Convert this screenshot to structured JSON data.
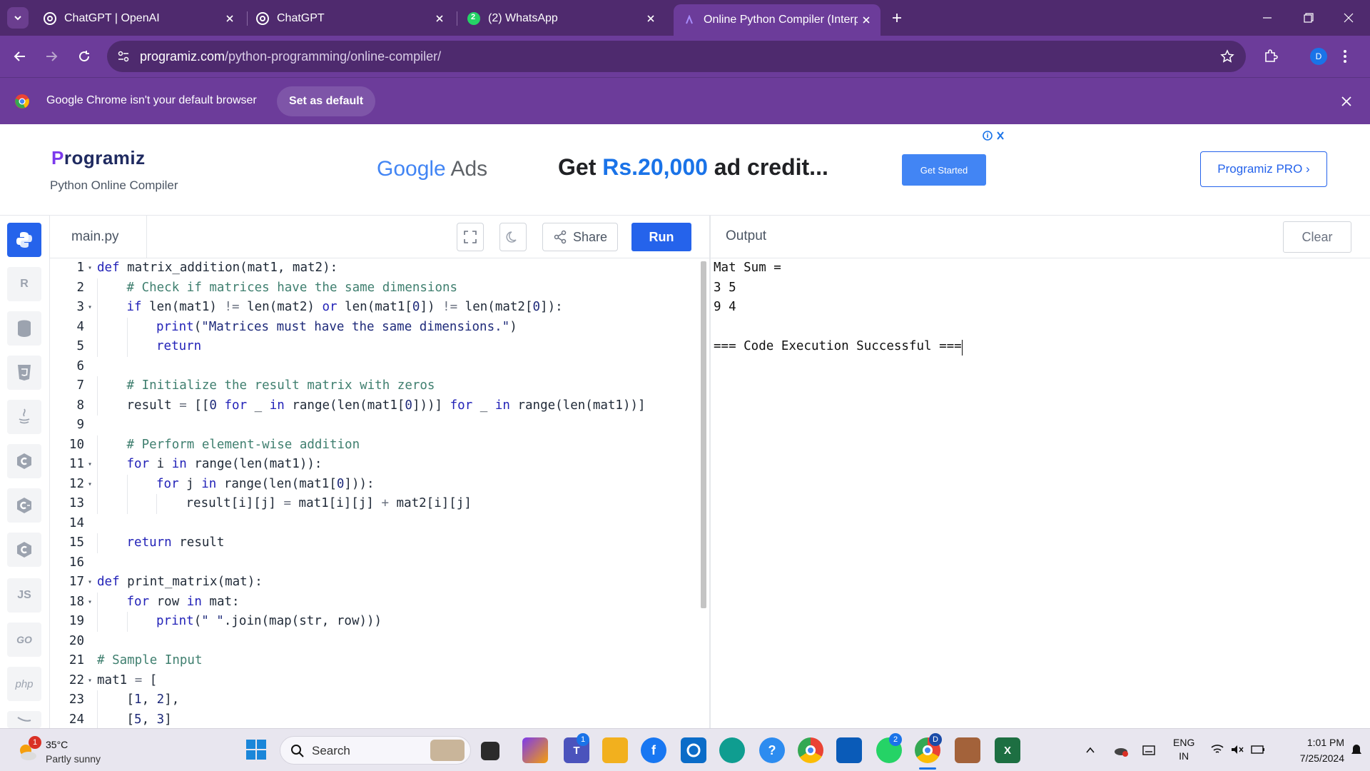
{
  "browser": {
    "tabs": [
      {
        "title": "ChatGPT | OpenAI",
        "icon": "openai-icon"
      },
      {
        "title": "ChatGPT",
        "icon": "openai-icon"
      },
      {
        "title": "(2) WhatsApp",
        "icon": "whatsapp-icon",
        "badge": "2"
      },
      {
        "title": "Online Python Compiler (Interp",
        "icon": "programiz-icon",
        "active": true
      }
    ],
    "url_host": "programiz.com",
    "url_path": "/python-programming/online-compiler/",
    "profile_initial": "D",
    "infobar": {
      "message": "Google Chrome isn't your default browser",
      "button": "Set as default"
    }
  },
  "header": {
    "logo": "rogramiz",
    "logo_initial": "P",
    "subtitle": "Python Online Compiler",
    "ad": {
      "brand_google": "Google",
      "brand_ads": "Ads",
      "text_before": "Get",
      "amount": "Rs.20,000",
      "text_after": "ad credit...",
      "cta": "Get Started"
    },
    "pro_button": "Programiz PRO ›"
  },
  "sidebar": {
    "languages": [
      {
        "name": "python",
        "label": "",
        "active": true
      },
      {
        "name": "r",
        "label": "R"
      },
      {
        "name": "sql",
        "label": ""
      },
      {
        "name": "html",
        "label": "5"
      },
      {
        "name": "java",
        "label": ""
      },
      {
        "name": "c",
        "label": "C"
      },
      {
        "name": "cpp",
        "label": "C"
      },
      {
        "name": "csharp",
        "label": "C"
      },
      {
        "name": "js",
        "label": "JS"
      },
      {
        "name": "go",
        "label": "GO"
      },
      {
        "name": "php",
        "label": "php"
      }
    ]
  },
  "editor": {
    "filename": "main.py",
    "share_label": "Share",
    "run_label": "Run",
    "lines": [
      {
        "n": "1",
        "fold": true,
        "indent": 0,
        "html": "<span class=\"kw\">def</span> matrix_addition(mat1, mat2):"
      },
      {
        "n": "2",
        "indent": 1,
        "html": "<span class=\"cm\"># Check if matrices have the same dimensions</span>"
      },
      {
        "n": "3",
        "fold": true,
        "indent": 1,
        "html": "<span class=\"kw\">if</span> len(mat1) <span class=\"op\">!=</span> len(mat2) <span class=\"kw\">or</span> len(mat1[<span class=\"st\">0</span>]) <span class=\"op\">!=</span> len(mat2[<span class=\"st\">0</span>]):"
      },
      {
        "n": "4",
        "indent": 2,
        "html": "<span class=\"kw\">print</span>(<span class=\"st\">\"Matrices must have the same dimensions.\"</span>)"
      },
      {
        "n": "5",
        "indent": 2,
        "html": "<span class=\"kw\">return</span>"
      },
      {
        "n": "6",
        "indent": 0,
        "html": ""
      },
      {
        "n": "7",
        "indent": 1,
        "html": "<span class=\"cm\"># Initialize the result matrix with zeros</span>"
      },
      {
        "n": "8",
        "indent": 1,
        "html": "result <span class=\"op\">=</span> [[<span class=\"st\">0</span> <span class=\"kw\">for</span> _ <span class=\"kw\">in</span> range(len(mat1[<span class=\"st\">0</span>]))] <span class=\"kw\">for</span> _ <span class=\"kw\">in</span> range(len(mat1))]"
      },
      {
        "n": "9",
        "indent": 0,
        "html": ""
      },
      {
        "n": "10",
        "indent": 1,
        "html": "<span class=\"cm\"># Perform element-wise addition</span>"
      },
      {
        "n": "11",
        "fold": true,
        "indent": 1,
        "html": "<span class=\"kw\">for</span> i <span class=\"kw\">in</span> range(len(mat1)):"
      },
      {
        "n": "12",
        "fold": true,
        "indent": 2,
        "html": "<span class=\"kw\">for</span> j <span class=\"kw\">in</span> range(len(mat1[<span class=\"st\">0</span>])):"
      },
      {
        "n": "13",
        "indent": 3,
        "html": "result[i][j] <span class=\"op\">=</span> mat1[i][j] <span class=\"op\">+</span> mat2[i][j]"
      },
      {
        "n": "14",
        "indent": 0,
        "html": ""
      },
      {
        "n": "15",
        "indent": 1,
        "html": "<span class=\"kw\">return</span> result"
      },
      {
        "n": "16",
        "indent": 0,
        "html": ""
      },
      {
        "n": "17",
        "fold": true,
        "indent": 0,
        "html": "<span class=\"kw\">def</span> print_matrix(mat):"
      },
      {
        "n": "18",
        "fold": true,
        "indent": 1,
        "html": "<span class=\"kw\">for</span> row <span class=\"kw\">in</span> mat:"
      },
      {
        "n": "19",
        "indent": 2,
        "html": "<span class=\"kw\">print</span>(<span class=\"st\">\" \"</span>.join(map(str, row)))"
      },
      {
        "n": "20",
        "indent": 0,
        "html": ""
      },
      {
        "n": "21",
        "indent": 0,
        "html": "<span class=\"cm\"># Sample Input</span>"
      },
      {
        "n": "22",
        "fold": true,
        "indent": 0,
        "html": "mat1 <span class=\"op\">=</span> ["
      },
      {
        "n": "23",
        "indent": 1,
        "html": "[<span class=\"st\">1</span>, <span class=\"st\">2</span>],"
      },
      {
        "n": "24",
        "indent": 1,
        "html": "[<span class=\"st\">5</span>, <span class=\"st\">3</span>]"
      }
    ]
  },
  "output": {
    "title": "Output",
    "clear_label": "Clear",
    "lines": [
      "Mat Sum = ",
      "3 5",
      "9 4",
      "",
      "=== Code Execution Successful ==="
    ]
  },
  "taskbar": {
    "weather_temp": "35°C",
    "weather_desc": "Partly sunny",
    "weather_badge": "1",
    "search_label": "Search",
    "lang_top": "ENG",
    "lang_bottom": "IN",
    "time": "1:01 PM",
    "date": "7/25/2024",
    "teams_badge": "1",
    "whatsapp_badge": "2",
    "chrome_profile": "D"
  }
}
